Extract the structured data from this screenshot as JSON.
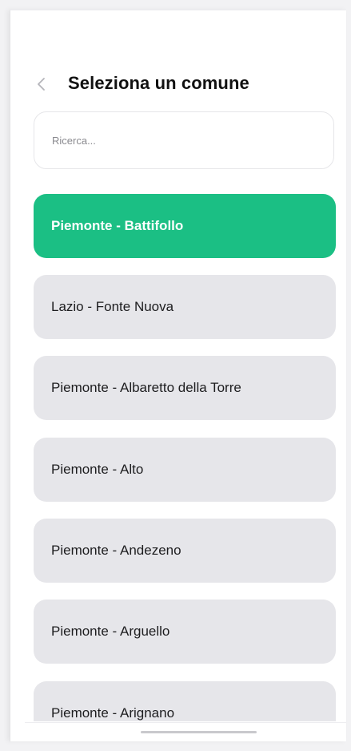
{
  "header": {
    "title": "Seleziona un comune",
    "back_icon": "chevron-left-icon"
  },
  "search": {
    "placeholder": "Ricerca...",
    "value": ""
  },
  "list": {
    "items": [
      {
        "label": "Piemonte - Battifollo",
        "selected": true
      },
      {
        "label": "Lazio - Fonte Nuova",
        "selected": false
      },
      {
        "label": "Piemonte - Albaretto della Torre",
        "selected": false
      },
      {
        "label": "Piemonte - Alto",
        "selected": false
      },
      {
        "label": "Piemonte - Andezeno",
        "selected": false
      },
      {
        "label": "Piemonte - Arguello",
        "selected": false
      },
      {
        "label": "Piemonte - Arignano",
        "selected": false
      }
    ]
  },
  "colors": {
    "accent": "#1bbf84",
    "item_bg": "#e6e6ea",
    "text": "#1d1d1f"
  }
}
